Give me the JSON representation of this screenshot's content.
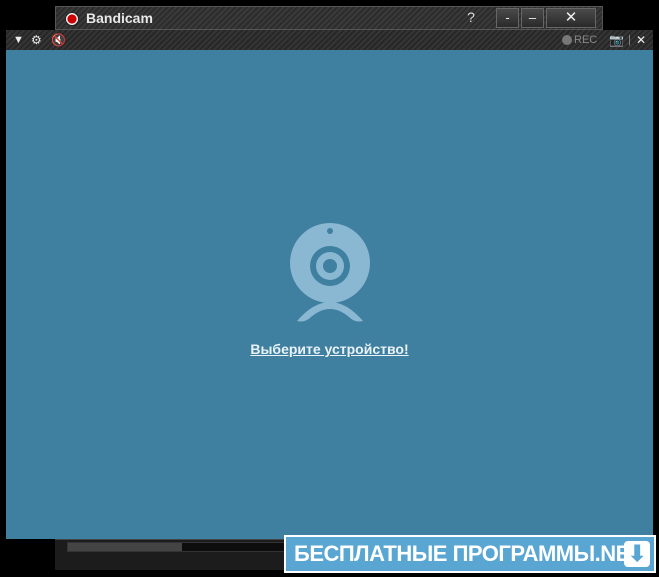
{
  "window": {
    "title": "Bandicam",
    "help_label": "?",
    "pin_label": "-",
    "min_label": "–",
    "close_label": "✕"
  },
  "toolbar": {
    "dropdown_glyph": "▼",
    "gear_glyph": "⚙",
    "mute_glyph": "🔇",
    "rec_label": "REC",
    "camera_glyph": "📷",
    "separator": "|",
    "close_glyph": "✕"
  },
  "preview": {
    "link_text": "Выберите устройство!"
  },
  "progress": {
    "value": 0.22
  },
  "banner": {
    "text": "БЕСПЛАТНЫЕ ПРОГРАММЫ.NET",
    "arrow_glyph": "⬇"
  },
  "colors": {
    "preview_bg": "#3f7f9f",
    "icon": "#8ab8d3",
    "banner": "#5aa6d2"
  }
}
